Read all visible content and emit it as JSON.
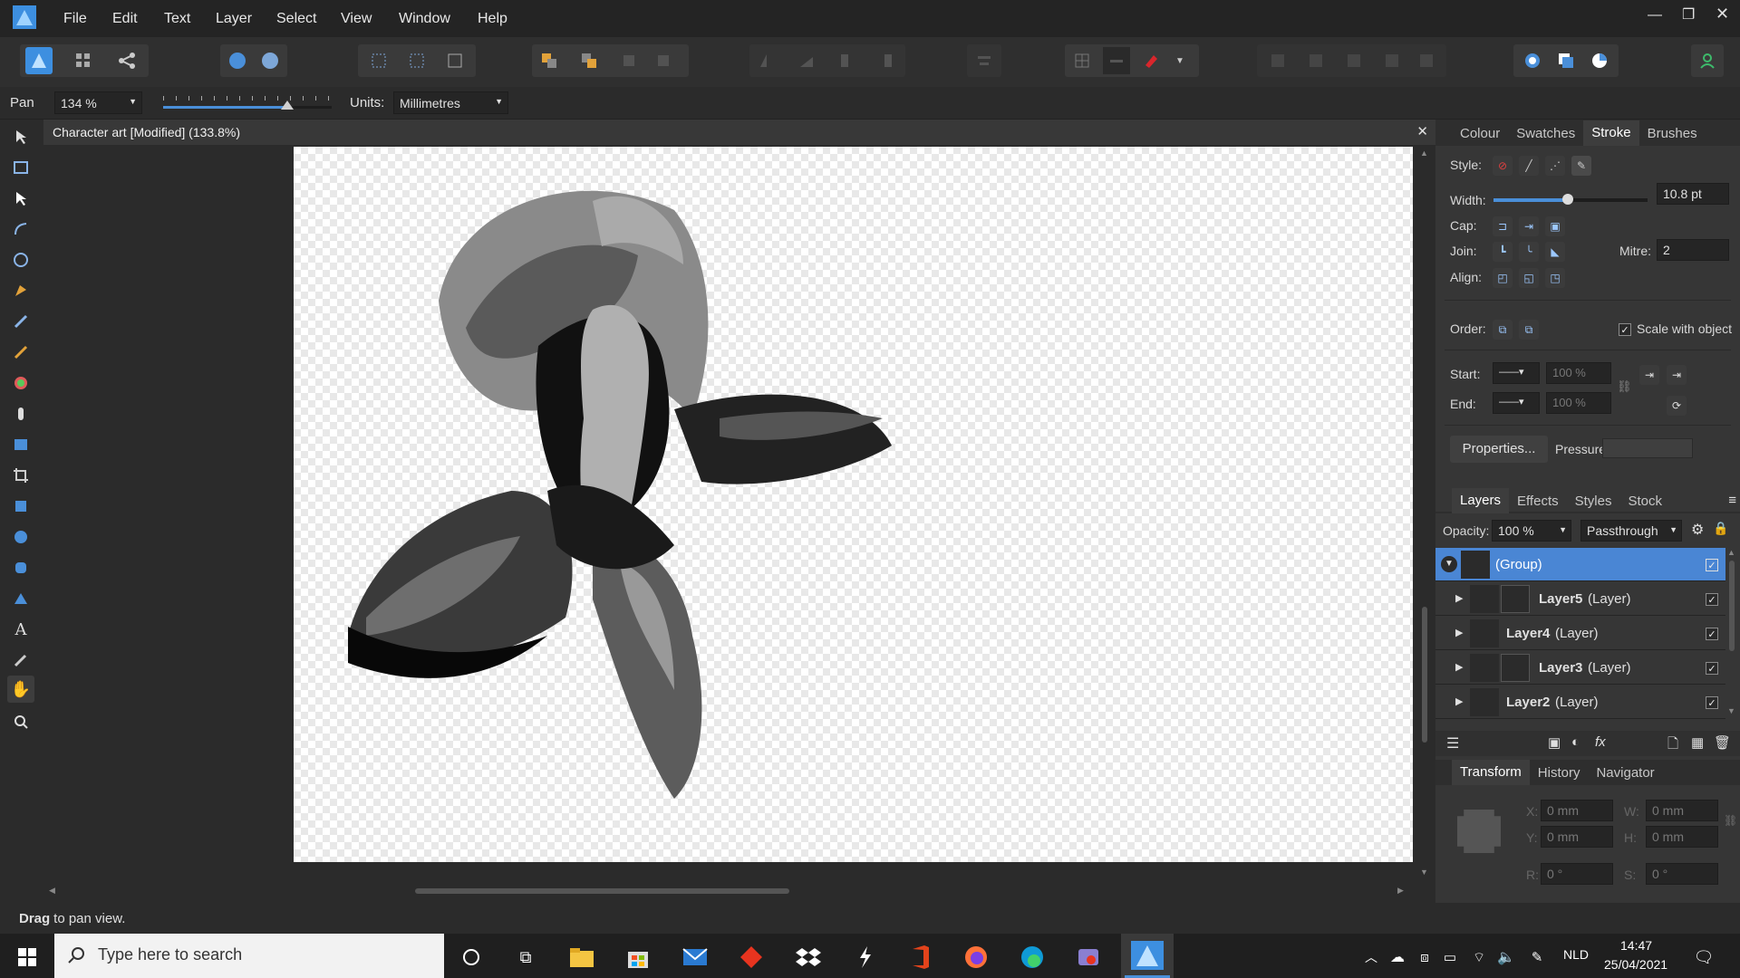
{
  "menubar": {
    "items": [
      "File",
      "Edit",
      "Text",
      "Layer",
      "Select",
      "View",
      "Window",
      "Help"
    ]
  },
  "context": {
    "tool_name": "Pan",
    "zoom": "134 %",
    "units_label": "Units:",
    "units_value": "Millimetres"
  },
  "document": {
    "title": "Character art [Modified] (133.8%)"
  },
  "stroke_panel": {
    "tabs": [
      "Colour",
      "Swatches",
      "Stroke",
      "Brushes"
    ],
    "active_tab": "Stroke",
    "style_label": "Style:",
    "width_label": "Width:",
    "width_value": "10.8 pt",
    "width_fraction": 0.48,
    "cap_label": "Cap:",
    "join_label": "Join:",
    "mitre_label": "Mitre:",
    "mitre_value": "2",
    "align_label": "Align:",
    "order_label": "Order:",
    "scale_label": "Scale with object",
    "start_label": "Start:",
    "end_label": "End:",
    "start_pct": "100 %",
    "end_pct": "100 %",
    "properties_label": "Properties...",
    "pressure_label": "Pressure:"
  },
  "layers_panel": {
    "tabs": [
      "Layers",
      "Effects",
      "Styles",
      "Stock"
    ],
    "active_tab": "Layers",
    "opacity_label": "Opacity:",
    "opacity_value": "100 %",
    "blend_mode": "Passthrough",
    "layers": [
      {
        "name": "(Group)",
        "type": ""
      },
      {
        "name": "Layer5",
        "type": "(Layer)"
      },
      {
        "name": "Layer4",
        "type": "(Layer)"
      },
      {
        "name": "Layer3",
        "type": "(Layer)"
      },
      {
        "name": "Layer2",
        "type": "(Layer)"
      }
    ]
  },
  "transform_panel": {
    "tabs": [
      "Transform",
      "History",
      "Navigator"
    ],
    "active_tab": "Transform",
    "x_label": "X:",
    "x": "0 mm",
    "y_label": "Y:",
    "y": "0 mm",
    "w_label": "W:",
    "w": "0 mm",
    "h_label": "H:",
    "h": "0 mm",
    "r_label": "R:",
    "r": "0 °",
    "s_label": "S:",
    "s": "0 °"
  },
  "status": {
    "bold": "Drag",
    "text": " to pan view."
  },
  "taskbar": {
    "search_placeholder": "Type here to search",
    "lang": "NLD",
    "time": "14:47",
    "date": "25/04/2021"
  },
  "colors": {
    "accent": "#4a8fd9",
    "selected_layer": "#4a86d4"
  }
}
